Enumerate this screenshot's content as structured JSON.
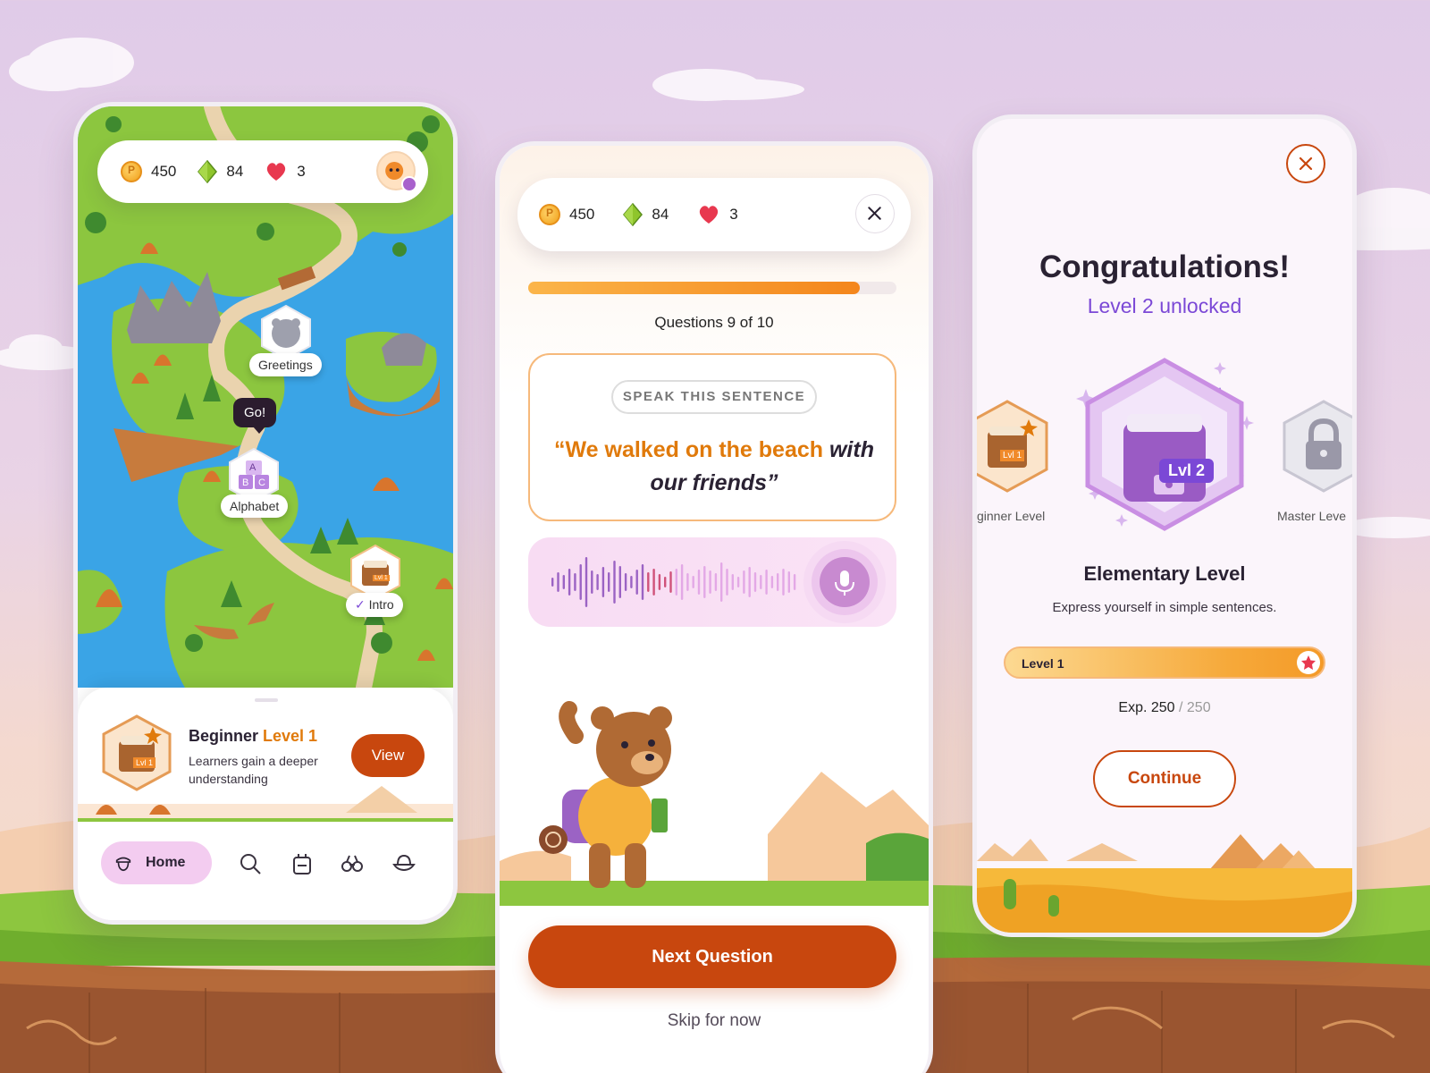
{
  "stats": {
    "coins": "450",
    "gems": "84",
    "hearts": "3"
  },
  "map": {
    "nodes": {
      "greetings": "Greetings",
      "alphabet": "Alphabet",
      "intro": "Intro"
    },
    "go_bubble": "Go!",
    "badge_text": "Lvl 1",
    "alphabet_letters": {
      "a": "A",
      "b": "B",
      "c": "C"
    }
  },
  "level_card": {
    "title_prefix": "Beginner",
    "title_level": "Level 1",
    "description": "Learners gain a deeper understanding",
    "view_label": "View",
    "badge_text": "Lvl 1"
  },
  "nav": {
    "home_label": "Home"
  },
  "quiz": {
    "progress": 0.9,
    "question_count": "Questions 9 of 10",
    "chip": "SPEAK THIS SENTENCE",
    "sentence_highlight": "“We walked on the beach",
    "sentence_rest": " with our friends”",
    "next_label": "Next Question",
    "skip_label": "Skip for now"
  },
  "congrats": {
    "title": "Congratulations!",
    "subtitle": "Level 2 unlocked",
    "left_label": "ginner Level",
    "right_label": "Master Leve",
    "badge_text": "Lvl 2",
    "left_badge_text": "Lvl 1",
    "level_name": "Elementary Level",
    "level_desc": "Express yourself in simple sentences.",
    "exp_bar_label": "Level 1",
    "exp_prefix": "Exp. 250",
    "exp_max": " / 250",
    "exp_progress": 1.0,
    "continue_label": "Continue"
  },
  "colors": {
    "accent_orange": "#c8470e",
    "highlight_orange": "#e07a0b",
    "purple": "#7b48d6",
    "pink_soft": "#f3ccf0"
  }
}
